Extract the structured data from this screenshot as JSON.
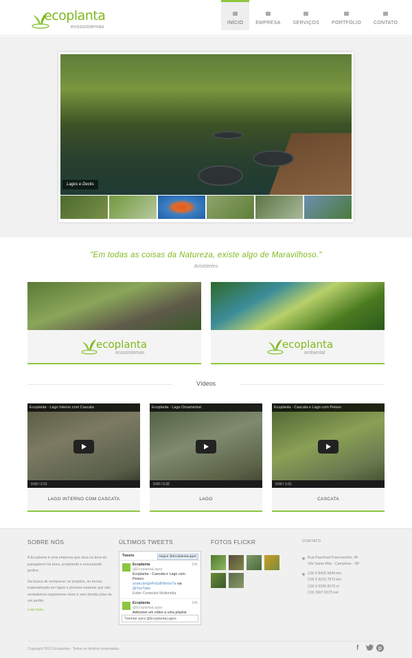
{
  "header": {
    "logo_text": "ecoplanta",
    "logo_sub": "ecossistemas",
    "nav": [
      {
        "label": "INÍCIO",
        "icon": "home-icon"
      },
      {
        "label": "EMPRESA",
        "icon": "leaf-icon"
      },
      {
        "label": "SERVIÇOS",
        "icon": "list-icon"
      },
      {
        "label": "PORTFÓLIO",
        "icon": "camera-icon"
      },
      {
        "label": "CONTATO",
        "icon": "envelope-icon"
      }
    ]
  },
  "slider": {
    "caption": "Lagos e Decks"
  },
  "quote": {
    "text": "\"Em todas as coisas da Natureza, existe algo de Maravilhoso.\"",
    "author": "Aristóteles"
  },
  "brands": [
    {
      "name": "ecoplanta",
      "sub": "ecossistemas"
    },
    {
      "name": "ecoplanta",
      "sub": "ambiental"
    }
  ],
  "videos_title": "Vídeos",
  "videos": [
    {
      "title": "Ecoplanta - Lago Interno com Cascata",
      "time": "0:00 / 2:21",
      "caption": "LAGO INTERNO COM CASCATA"
    },
    {
      "title": "Ecoplanta - Lago Ornamental",
      "time": "0:00 / 0:32",
      "caption": "LAGO"
    },
    {
      "title": "Ecoplanta - Cascata e Lago com Peixes",
      "time": "0:00 / 1:01",
      "caption": "CASCATA"
    }
  ],
  "footer": {
    "about": {
      "heading": "SOBRE NÓS",
      "p1": "A Ecoplanta é uma empresa que atua na área de paisagismo há anos, projetando e executando jardins.",
      "p2": "Na busca de enriquecer os projetos, se tornou especializada em lagos e piscinas naturais que são verdadeiros organismos vivos e sem dúvida jóias de um jardim.",
      "more": "Leia mais..."
    },
    "tweets": {
      "heading": "ÚLTIMOS TWEETS",
      "widget_title": "Tweets",
      "follow": "Seguir @EcoplantaLagos",
      "t1_name": "Ecoplanta",
      "t1_handle": "@EcoplantaLagos",
      "t1_age": "10h",
      "t1_text": "Ecoplanta - Cascata e Lago com Peixes:",
      "t1_link": "youtu.be/gnPoGdF8xmo?a",
      "t1_via": "via",
      "t1_yt": "@YouTube",
      "t1_media": "Exibir Conteúdo Multimídia",
      "t2_name": "Ecoplanta",
      "t2_handle": "@EcoplantaLagos",
      "t2_age": "10h",
      "t2_text": "Adicionei um vídeo a uma playlist",
      "input": "Tweetar para @EcoplantaLagos"
    },
    "flickr": {
      "heading": "FOTOS FLICKR"
    },
    "contact": {
      "heading": "CONTATO",
      "address1": "Rua Paschoal Franceschini, 46",
      "address2": "Vila Santa Rita - Campinas - SP",
      "phones": [
        "(19) 9 8415 5694 tim",
        "(19) 9 9215 7573 tim",
        "(19) 9 9299 8175 vi",
        "(19) 3307 6573 net"
      ]
    },
    "copyright": "Copyright 2013 Ecoplanta - Todos os direitos reservados.",
    "social": [
      "facebook-icon",
      "twitter-icon",
      "pinterest-icon"
    ]
  },
  "colors": {
    "accent": "#8cc63f",
    "logo": "#7fb81e"
  }
}
